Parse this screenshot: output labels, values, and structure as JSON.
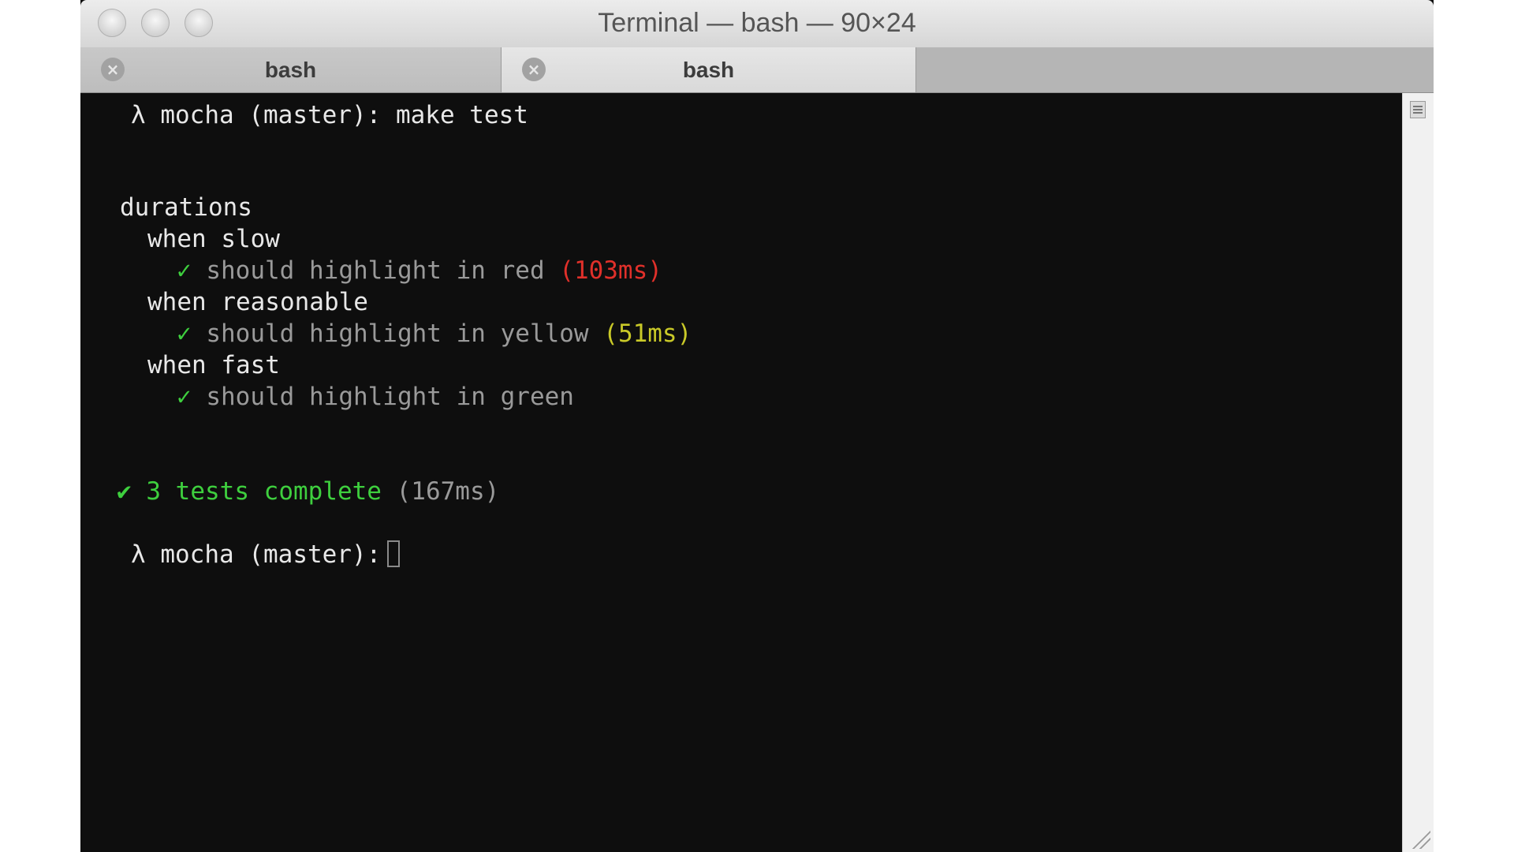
{
  "window": {
    "title": "Terminal — bash — 90×24"
  },
  "tabs": [
    {
      "label": "bash",
      "close": "×"
    },
    {
      "label": "bash",
      "close": "×"
    }
  ],
  "terminal": {
    "prompt1": {
      "symbol": "λ",
      "text": "mocha (master): make test"
    },
    "suite": "durations",
    "groups": [
      {
        "title": "when slow",
        "check": "✓",
        "test": "should highlight in red",
        "duration": "(103ms)"
      },
      {
        "title": "when reasonable",
        "check": "✓",
        "test": "should highlight in yellow",
        "duration": "(51ms)"
      },
      {
        "title": "when fast",
        "check": "✓",
        "test": "should highlight in green",
        "duration": ""
      }
    ],
    "summary": {
      "check": "✔",
      "text": "3 tests complete",
      "duration": "(167ms)"
    },
    "prompt2": {
      "symbol": "λ",
      "text": "mocha (master):"
    }
  },
  "colors": {
    "background": "#0e0e0e",
    "pass": "#3ecf3e",
    "slow": "#e0302a",
    "medium": "#c9c928",
    "muted": "#9a9a9a"
  }
}
